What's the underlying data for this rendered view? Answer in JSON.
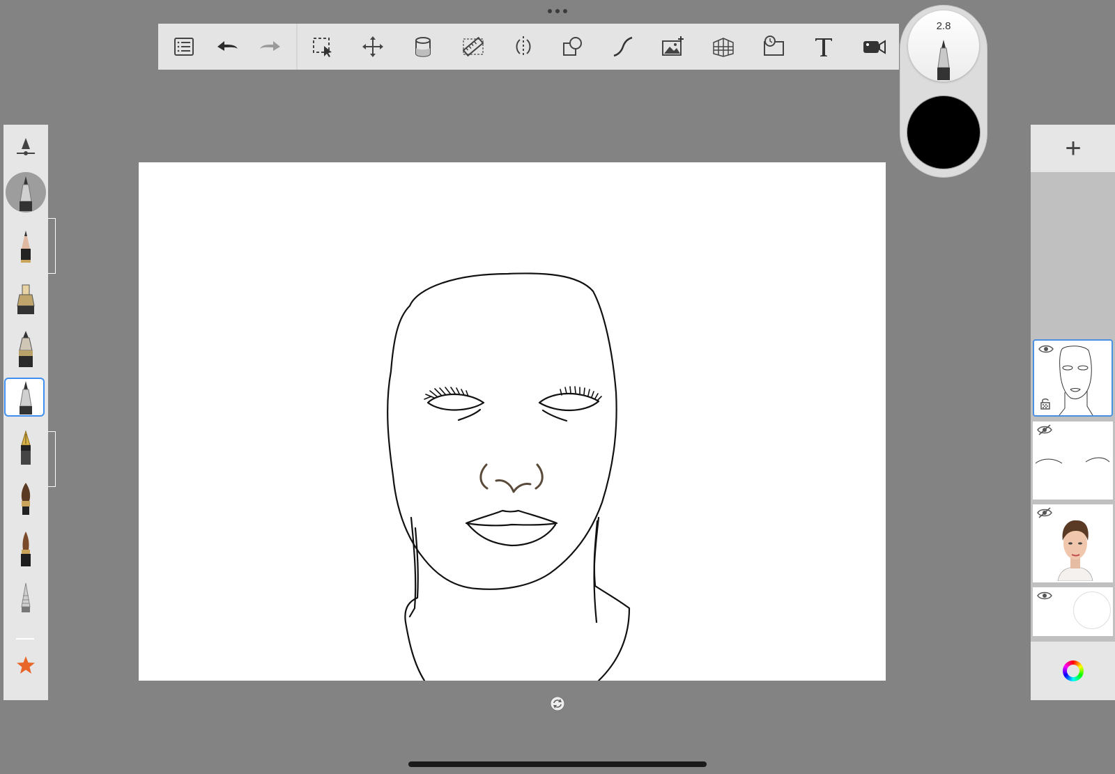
{
  "app": {
    "background": "#838383",
    "accent": "#4a90e2"
  },
  "toolbar": {
    "tools": [
      {
        "name": "list-icon"
      },
      {
        "name": "undo-icon"
      },
      {
        "name": "redo-icon"
      },
      {
        "name": "selection-icon"
      },
      {
        "name": "transform-icon"
      },
      {
        "name": "fill-bucket-icon"
      },
      {
        "name": "ruler-icon"
      },
      {
        "name": "symmetry-icon"
      },
      {
        "name": "shapes-icon"
      },
      {
        "name": "curve-icon"
      },
      {
        "name": "add-image-icon"
      },
      {
        "name": "perspective-grid-icon"
      },
      {
        "name": "time-lapse-icon"
      },
      {
        "name": "text-icon"
      },
      {
        "name": "record-icon"
      }
    ]
  },
  "brush_puck": {
    "size_value": "2.8",
    "current_color": "#000000"
  },
  "brush_palette": {
    "items": [
      {
        "name": "brush-settings-icon"
      },
      {
        "name": "current-brush-icon"
      },
      {
        "name": "pencil-icon"
      },
      {
        "name": "marker-icon"
      },
      {
        "name": "ink-pen-icon"
      },
      {
        "name": "ballpoint-pen-icon",
        "selected": true
      },
      {
        "name": "fountain-pen-icon"
      },
      {
        "name": "paint-brush-icon"
      },
      {
        "name": "airbrush-icon"
      },
      {
        "name": "blender-icon"
      },
      {
        "name": "favorites-star-icon"
      }
    ]
  },
  "layers": {
    "add_label": "+",
    "items": [
      {
        "name": "layer-face-lineart",
        "visible": true,
        "active": true
      },
      {
        "name": "layer-eyebrows",
        "visible": false,
        "active": false
      },
      {
        "name": "layer-reference-photo",
        "visible": false,
        "active": false
      },
      {
        "name": "layer-background",
        "visible": true,
        "active": false
      }
    ]
  }
}
